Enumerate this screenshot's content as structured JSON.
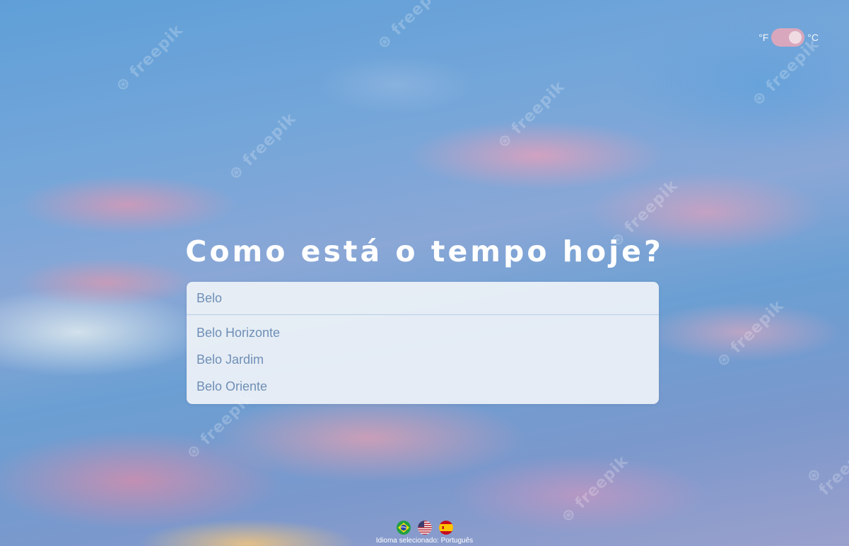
{
  "unit_toggle": {
    "left_label": "°F",
    "right_label": "°C",
    "selected": "°C"
  },
  "title": "Como está o tempo hoje?",
  "search": {
    "value": "Belo",
    "suggestions": [
      "Belo Horizonte",
      "Belo Jardim",
      "Belo Oriente"
    ]
  },
  "languages": {
    "flags": [
      "brazil-flag-icon",
      "usa-flag-icon",
      "spain-flag-icon"
    ],
    "selected_label": "Idioma selecionado: Português"
  },
  "colors": {
    "toggle_track": "#d9a7bd",
    "text_accent": "#6f8fb6"
  }
}
